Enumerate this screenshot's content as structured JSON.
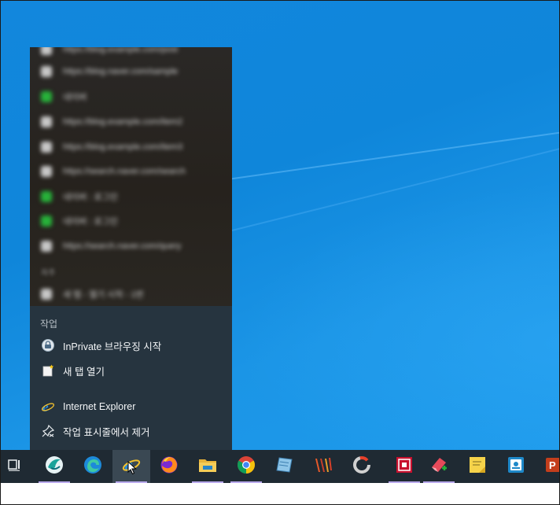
{
  "jumplist": {
    "recent_items": [
      {
        "text": "https://blog.example.com/post",
        "color": "gray"
      },
      {
        "text": "https://blog.naver.com/sample",
        "color": "gray"
      },
      {
        "text": "네이버",
        "color": "green"
      },
      {
        "text": "https://blog.example.com/item2",
        "color": "gray"
      },
      {
        "text": "https://blog.example.com/item3",
        "color": "gray"
      },
      {
        "text": "https://search.naver.com/search",
        "color": "gray"
      },
      {
        "text": "네이버 : 로그인",
        "color": "green"
      },
      {
        "text": "네이버 : 로그인",
        "color": "green"
      },
      {
        "text": "https://search.naver.com/query",
        "color": "gray"
      }
    ],
    "recent_section_label": "자주",
    "recent_pinned": {
      "text": "새 탭 - 열기 시작 - 1번",
      "color": "gray"
    },
    "tasks_title": "작업",
    "tasks": [
      {
        "label": "InPrivate 브라우징 시작",
        "icon": "inprivate-icon"
      },
      {
        "label": "새 탭 열기",
        "icon": "new-tab-icon"
      }
    ],
    "app_items": [
      {
        "label": "Internet Explorer",
        "icon": "internet-explorer-icon"
      },
      {
        "label": "작업 표시줄에서 제거",
        "icon": "unpin-icon"
      }
    ]
  },
  "taskbar": {
    "buttons": [
      {
        "icon": "task-view-icon",
        "running": false,
        "active": false
      },
      {
        "icon": "app-bird-icon",
        "running": true,
        "active": false
      },
      {
        "icon": "microsoft-edge-icon",
        "running": false,
        "active": false
      },
      {
        "icon": "internet-explorer-icon",
        "running": true,
        "active": true
      },
      {
        "icon": "firefox-icon",
        "running": false,
        "active": false
      },
      {
        "icon": "file-explorer-icon",
        "running": true,
        "active": false
      },
      {
        "icon": "chrome-icon",
        "running": true,
        "active": false
      },
      {
        "icon": "notepad-app-icon",
        "running": false,
        "active": false
      },
      {
        "icon": "app-stripes-icon",
        "running": false,
        "active": false
      },
      {
        "icon": "app-ring-icon",
        "running": false,
        "active": false
      },
      {
        "icon": "app-red-square-icon",
        "running": true,
        "active": false
      },
      {
        "icon": "app-eraser-icon",
        "running": true,
        "active": false
      },
      {
        "icon": "sticky-notes-icon",
        "running": false,
        "active": false
      },
      {
        "icon": "app-blue-icon",
        "running": false,
        "active": false
      },
      {
        "icon": "powerpoint-icon",
        "running": false,
        "active": false
      }
    ]
  },
  "colors": {
    "desktop": "#1287dd",
    "jumplist_tasks_bg": "#26343f",
    "taskbar_bg": "#1f2a33",
    "running_indicator": "#b8a8ec"
  }
}
